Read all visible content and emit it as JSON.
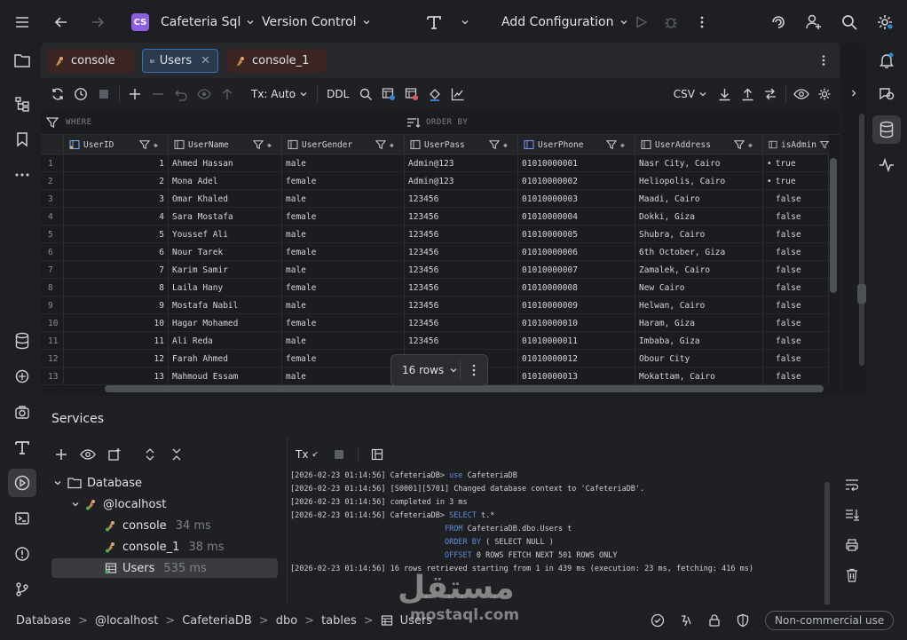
{
  "titlebar": {
    "project_initials": "CS",
    "project_name": "Cafeteria Sql",
    "vcs_label": "Version Control",
    "run_config_label": "Add Configuration"
  },
  "tabs": [
    {
      "label": "console"
    },
    {
      "label": "Users"
    },
    {
      "label": "console_1"
    }
  ],
  "toolbar": {
    "tx_mode": "Tx: Auto",
    "ddl_label": "DDL",
    "export_format": "CSV"
  },
  "filter": {
    "where_label": "WHERE",
    "orderby_label": "ORDER BY"
  },
  "grid": {
    "columns": [
      "UserID",
      "UserName",
      "UserGender",
      "UserPass",
      "UserPhone",
      "UserAddress",
      "isAdmin"
    ],
    "rows": [
      [
        "1",
        "1",
        "Ahmed Hassan",
        "male",
        "Admin@123",
        "01010000001",
        "Nasr City, Cairo",
        "true"
      ],
      [
        "2",
        "2",
        "Mona Adel",
        "female",
        "Admin@123",
        "01010000002",
        "Heliopolis, Cairo",
        "true"
      ],
      [
        "3",
        "3",
        "Omar Khaled",
        "male",
        "123456",
        "01010000003",
        "Maadi, Cairo",
        "false"
      ],
      [
        "4",
        "4",
        "Sara Mostafa",
        "female",
        "123456",
        "01010000004",
        "Dokki, Giza",
        "false"
      ],
      [
        "5",
        "5",
        "Youssef Ali",
        "male",
        "123456",
        "01010000005",
        "Shubra, Cairo",
        "false"
      ],
      [
        "6",
        "6",
        "Nour Tarek",
        "female",
        "123456",
        "01010000006",
        "6th October, Giza",
        "false"
      ],
      [
        "7",
        "7",
        "Karim Samir",
        "male",
        "123456",
        "01010000007",
        "Zamalek, Cairo",
        "false"
      ],
      [
        "8",
        "8",
        "Laila Hany",
        "female",
        "123456",
        "01010000008",
        "New Cairo",
        "false"
      ],
      [
        "9",
        "9",
        "Mostafa Nabil",
        "male",
        "123456",
        "01010000009",
        "Helwan, Cairo",
        "false"
      ],
      [
        "10",
        "10",
        "Hagar Mohamed",
        "female",
        "123456",
        "01010000010",
        "Haram, Giza",
        "false"
      ],
      [
        "11",
        "11",
        "Ali Reda",
        "male",
        "123456",
        "01010000011",
        "Imbaba, Giza",
        "false"
      ],
      [
        "12",
        "12",
        "Farah Ahmed",
        "female",
        "",
        "01010000012",
        "Obour City",
        "false"
      ],
      [
        "13",
        "13",
        "Mahmoud Essam",
        "male",
        "",
        "01010000013",
        "Mokattam, Cairo",
        "false"
      ]
    ],
    "row_count_label": "16 rows"
  },
  "services": {
    "title": "Services",
    "tree": [
      {
        "label": "Database",
        "ms": ""
      },
      {
        "label": "@localhost",
        "ms": ""
      },
      {
        "label": "console",
        "ms": "34 ms"
      },
      {
        "label": "console_1",
        "ms": "38 ms"
      },
      {
        "label": "Users",
        "ms": "535 ms"
      }
    ],
    "console_tx": "Tx",
    "log": [
      {
        "ts": "[2026-02-23 01:14:56]",
        "prefix": " CafeteriaDB> ",
        "kw": "use",
        "text": " CafeteriaDB"
      },
      {
        "ts": "[2026-02-23 01:14:56]",
        "prefix": " [S0001][5701] Changed database context to 'CafeteriaDB'.",
        "kw": "",
        "text": ""
      },
      {
        "ts": "[2026-02-23 01:14:56]",
        "prefix": " completed in 3 ms",
        "kw": "",
        "text": ""
      },
      {
        "ts": "[2026-02-23 01:14:56]",
        "prefix": " CafeteriaDB> ",
        "kw": "SELECT",
        "text": " t.*"
      },
      {
        "ts": "",
        "prefix": "",
        "kw": "FROM",
        "text": " CafeteriaDB.dbo.Users t"
      },
      {
        "ts": "",
        "prefix": "",
        "kw": "ORDER BY",
        "text": " ( SELECT NULL )"
      },
      {
        "ts": "",
        "prefix": "",
        "kw": "OFFSET",
        "text": " 0 ROWS FETCH NEXT 501 ROWS ONLY"
      },
      {
        "ts": "[2026-02-23 01:14:56]",
        "prefix": " 16 rows retrieved starting from 1 in 439 ms (execution: 23 ms, fetching: 416 ms)",
        "kw": "",
        "text": ""
      }
    ]
  },
  "statusbar": {
    "crumbs": [
      "Database",
      "@localhost",
      "CafeteriaDB",
      "dbo",
      "tables",
      "Users"
    ],
    "license": "Non-commercial use"
  },
  "watermark": {
    "arabic": "مستقل",
    "latin": "mostaql.com"
  }
}
